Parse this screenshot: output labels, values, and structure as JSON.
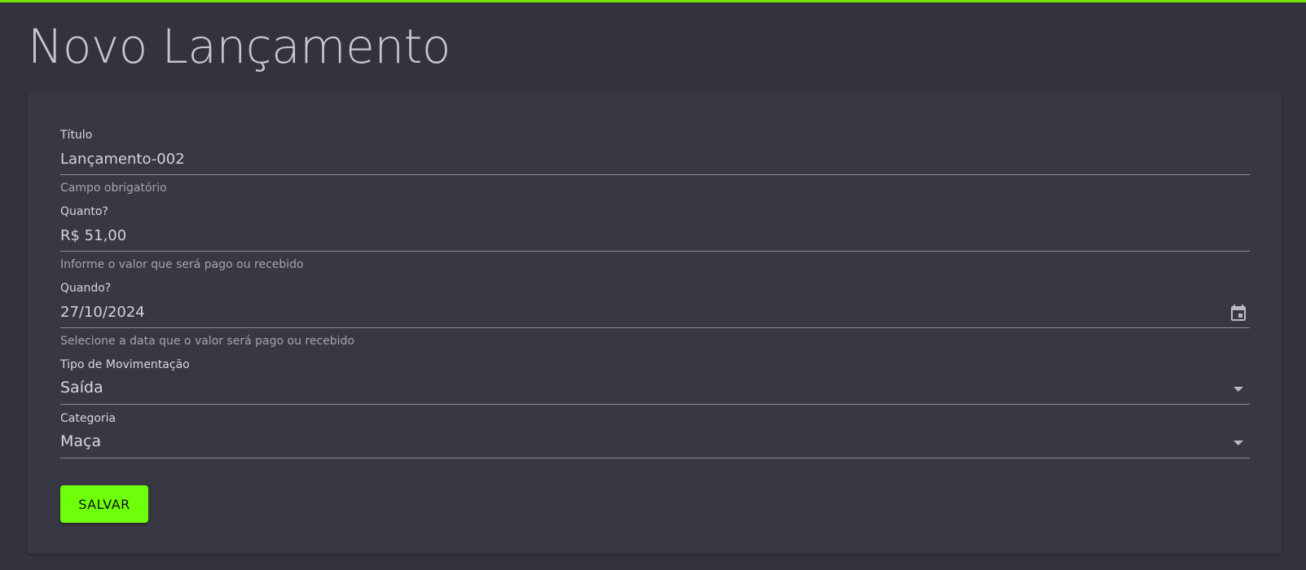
{
  "page": {
    "title": "Novo Lançamento"
  },
  "colors": {
    "accent": "#6eff0a",
    "background": "#32333d",
    "card": "#373843"
  },
  "form": {
    "titulo": {
      "label": "Título",
      "value": "Lançamento-002",
      "hint": "Campo obrigatório"
    },
    "quanto": {
      "label": "Quanto?",
      "value": "R$ 51,00",
      "hint": "Informe o valor que será pago ou recebido"
    },
    "quando": {
      "label": "Quando?",
      "value": "27/10/2024",
      "hint": "Selecione a data que o valor será pago ou recebido",
      "icon": "calendar-icon"
    },
    "tipo": {
      "label": "Tipo de Movimentação",
      "value": "Saída",
      "icon": "chevron-down-icon"
    },
    "categoria": {
      "label": "Categoria",
      "value": "Maça",
      "icon": "chevron-down-icon"
    },
    "save_label": "SALVAR"
  }
}
